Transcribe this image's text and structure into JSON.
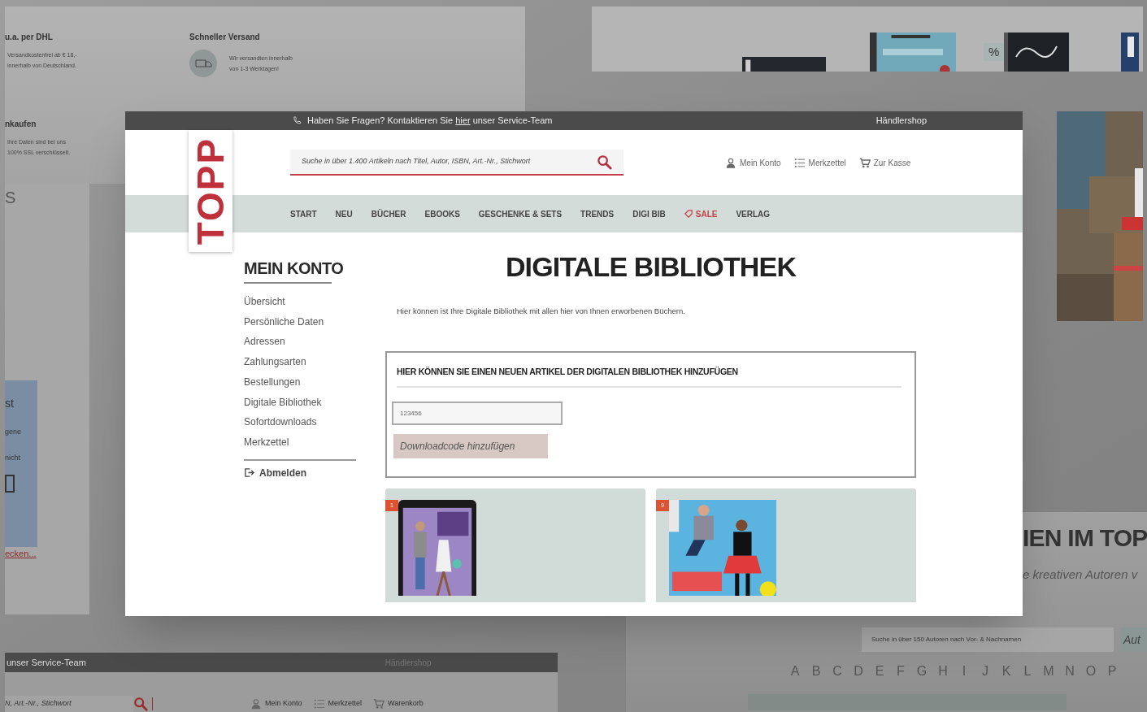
{
  "background": {
    "shipping_panel": {
      "items": [
        {
          "title": "u.a. per DHL",
          "lines": [
            "Versandkostenfrei ab € 18,-",
            "innerhalb von Deutschland."
          ],
          "icon": false
        },
        {
          "title": "Schneller Versand",
          "lines": [
            "Wir versandten innerhalb",
            "von 1-3 Werktagen!"
          ],
          "icon": true
        },
        {
          "title": "nkaufen",
          "lines": [
            "Ihre Daten sind bei uns",
            "100% SSL verschlüsselt."
          ],
          "icon": false
        }
      ]
    },
    "side_panel": {
      "heading": "S",
      "box_lines": [
        "st",
        "gene",
        "nicht"
      ],
      "link": "ecken..."
    },
    "products_panel": {
      "badge": "%"
    },
    "authors_panel": {
      "heading": "IEN IM TOP",
      "subtitle": "e kreativen Autoren v",
      "search_placeholder": "Suche in über 150 Autoren nach Vor- & Nachnamen",
      "button": "Aut",
      "letters": [
        "A",
        "B",
        "C",
        "D",
        "E",
        "F",
        "G",
        "H",
        "I",
        "J",
        "K",
        "L",
        "M",
        "N",
        "O",
        "P"
      ]
    },
    "shop_panel": {
      "service": "unser Service-Team",
      "dealer": "Händlershop",
      "search_placeholder": "N, Art.-Nr., Stichwort",
      "links": [
        {
          "kind": "account",
          "label": "Mein Konto"
        },
        {
          "kind": "list",
          "label": "Merkzettel"
        },
        {
          "kind": "cart",
          "label": "Warenkorb"
        }
      ]
    }
  },
  "screen": {
    "topbar": {
      "text_before": "Haben Sie Fragen? Kontaktieren Sie ",
      "link": "hier",
      "text_after": " unser Service-Team",
      "dealer": "Händlershop"
    },
    "logo": "TOPP",
    "search": {
      "placeholder": "Suche in über 1.400 Artikeln nach Titel, Autor, ISBN, Art.-Nr., Stichwort"
    },
    "account_links": [
      {
        "kind": "account",
        "label": "Mein Konto"
      },
      {
        "kind": "list",
        "label": "Merkzettel"
      },
      {
        "kind": "cart",
        "label": "Zur Kasse"
      }
    ],
    "nav": [
      {
        "label": "START",
        "sale": false
      },
      {
        "label": "NEU",
        "sale": false
      },
      {
        "label": "BÜCHER",
        "sale": false
      },
      {
        "label": "EBOOKS",
        "sale": false
      },
      {
        "label": "GESCHENKE & SETS",
        "sale": false
      },
      {
        "label": "TRENDS",
        "sale": false
      },
      {
        "label": "DIGI BIB",
        "sale": false
      },
      {
        "label": "SALE",
        "sale": true
      },
      {
        "label": "VERLAG",
        "sale": false
      }
    ],
    "sidebar": {
      "title": "MEIN KONTO",
      "items": [
        "Übersicht",
        "Persönliche Daten",
        "Adressen",
        "Zahlungsarten",
        "Bestellungen",
        "Digitale Bibliothek",
        "Sofortdownloads",
        "Merkzettel"
      ],
      "logout": "Abmelden"
    },
    "page": {
      "title": "DIGITALE BIBLIOTHEK",
      "intro": "Hier können ist Ihre Digitale Bibliothek mit allen hier von Ihnen erworbenen Büchern.",
      "add_box": {
        "title": "HIER KÖNNEN SIE EINEN NEUEN ARTIKEL DER DIGITALEN BIBLIOTHEK HINZUFÜGEN",
        "code": "123456",
        "button": "Downloadcode hinzufügen"
      },
      "books": [
        {
          "badge": "1",
          "kind": "tablet"
        },
        {
          "badge": "9",
          "kind": "cover"
        }
      ]
    }
  }
}
